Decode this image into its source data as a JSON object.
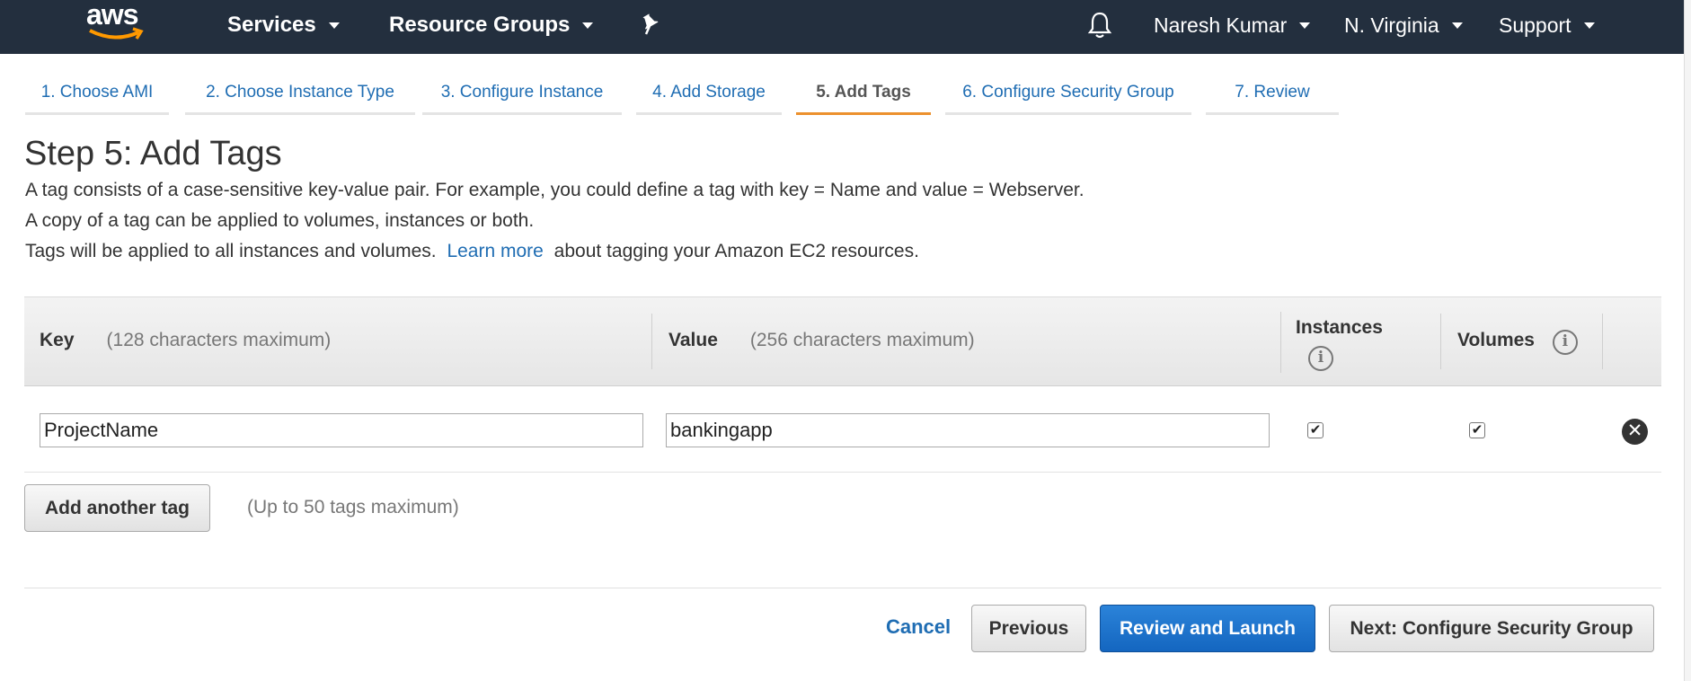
{
  "topnav": {
    "logo_text": "aws",
    "services_label": "Services",
    "resource_groups_label": "Resource Groups",
    "user_label": "Naresh Kumar",
    "region_label": "N. Virginia",
    "support_label": "Support",
    "background_color": "#232f3e"
  },
  "wizard": {
    "tabs": [
      {
        "label": "1. Choose AMI",
        "active": false
      },
      {
        "label": "2. Choose Instance Type",
        "active": false
      },
      {
        "label": "3. Configure Instance",
        "active": false
      },
      {
        "label": "4. Add Storage",
        "active": false
      },
      {
        "label": "5. Add Tags",
        "active": true
      },
      {
        "label": "6. Configure Security Group",
        "active": false
      },
      {
        "label": "7. Review",
        "active": false
      }
    ],
    "active_color": "#ec912d",
    "link_color": "#1f6db3"
  },
  "page": {
    "title": "Step 5: Add Tags",
    "desc_line1": "A tag consists of a case-sensitive key-value pair. For example, you could define a tag with key = Name and value = Webserver.",
    "desc_line2": "A copy of a tag can be applied to volumes, instances or both.",
    "desc_line3_pre": "Tags will be applied to all instances and volumes.",
    "desc_line3_link": "Learn more",
    "desc_line3_post": "about tagging your Amazon EC2 resources."
  },
  "table": {
    "headers": {
      "key": "Key",
      "key_hint": "(128 characters maximum)",
      "value": "Value",
      "value_hint": "(256 characters maximum)",
      "instances": "Instances",
      "volumes": "Volumes"
    },
    "rows": [
      {
        "key": "ProjectName",
        "value": "bankingapp",
        "instances": true,
        "volumes": true
      }
    ]
  },
  "actions": {
    "add_tag_label": "Add another tag",
    "limit_note": "(Up to 50 tags maximum)",
    "cancel_label": "Cancel",
    "previous_label": "Previous",
    "review_launch_label": "Review and Launch",
    "next_label": "Next: Configure Security Group",
    "primary_color": "#1466c0"
  }
}
